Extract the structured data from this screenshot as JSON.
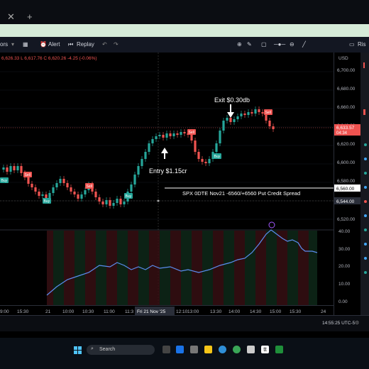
{
  "toolbar": {
    "indicators_label": "ors",
    "alert_label": "Alert",
    "replay_label": "Replay"
  },
  "ohlc": "6,626.33  L 6,617.76  C 6,620.26  -4.25 (-0.06%)",
  "currency": "USD",
  "price_axis": {
    "ticks": [
      "6,700.00",
      "6,680.00",
      "6,660.00",
      "6,640.00",
      "6,620.00",
      "6,600.00",
      "6,580.00",
      "6,560.00",
      "6,544.00",
      "6,520.00"
    ],
    "spx_tag": "SPX",
    "spx_price": "6,633.57",
    "spx_countdown": "04:34",
    "level_560": "6,560.00",
    "level_544": "6,544.00"
  },
  "osc_axis": [
    "40.00",
    "30.00",
    "20.00",
    "10.00",
    "0.00"
  ],
  "time_axis": [
    "9:00",
    "15:30",
    "21",
    "10:00",
    "10:30",
    "11:00",
    "11:3",
    "12:10",
    "13:00",
    "13:30",
    "14:00",
    "14:30",
    "15:00",
    "15:30",
    "24"
  ],
  "time_cursor": "Fri 21 Nov '25",
  "annotations": {
    "exit": "Exit $0.30db",
    "entry": "Entry $1.15cr",
    "trade": "SPX 0DTE Nov21 -6560/+6560 Put Credit Spread"
  },
  "signals": {
    "sell": "Sell",
    "buy": "Buy"
  },
  "status": {
    "time": "14:55:25 UTC-5"
  },
  "taskbar": {
    "search_placeholder": "Search"
  },
  "colors": {
    "up": "#26a69a",
    "down": "#ef5350",
    "osc_line": "#5b8def",
    "accent": "#4caf50"
  },
  "right_edge": "Ris"
}
